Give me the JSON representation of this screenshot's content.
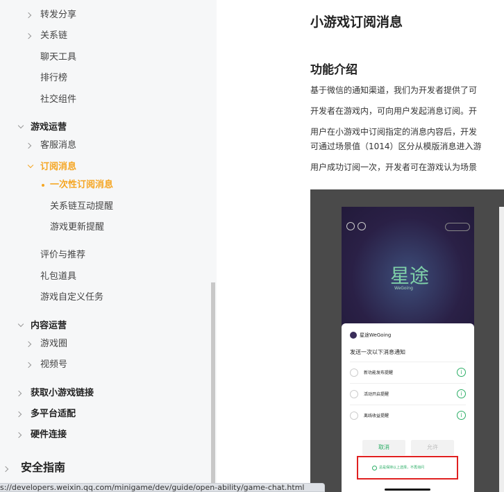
{
  "sidebar": {
    "items": [
      {
        "label": "转发分享"
      },
      {
        "label": "关系链"
      },
      {
        "label": "聊天工具"
      },
      {
        "label": "排行榜"
      },
      {
        "label": "社交组件"
      },
      {
        "label": "游戏运营"
      },
      {
        "label": "客服消息"
      },
      {
        "label": "订阅消息"
      },
      {
        "label": "一次性订阅消息"
      },
      {
        "label": "关系链互动提醒"
      },
      {
        "label": "游戏更新提醒"
      },
      {
        "label": "评价与推荐"
      },
      {
        "label": "礼包道具"
      },
      {
        "label": "游戏自定义任务"
      },
      {
        "label": "内容运营"
      },
      {
        "label": "游戏圈"
      },
      {
        "label": "视频号"
      },
      {
        "label": "获取小游戏链接"
      },
      {
        "label": "多平台适配"
      },
      {
        "label": "硬件连接"
      },
      {
        "label": "安全指南"
      }
    ]
  },
  "content": {
    "title": "小游戏订阅消息",
    "section_title": "功能介绍",
    "paragraphs": [
      "基于微信的通知渠道，我们为开发者提供了可",
      "开发者在游戏内，可向用户发起消息订阅。开",
      "用户在小游戏中订阅指定的消息内容后，开发",
      "可通过场景值（1014）区分从模版消息进入游",
      "用户成功订阅一次，开发者可在游戏认为场景"
    ]
  },
  "screenshot": {
    "logo_text": "星途",
    "logo_sub": "WeGoing",
    "app_name": "星途WeGoing",
    "sheet_title": "发送一次以下消息通知",
    "options": [
      {
        "label": "新功能发布提醒"
      },
      {
        "label": "活动开启提醒"
      },
      {
        "label": "离线收益提醒"
      }
    ],
    "cancel_label": "取消",
    "allow_label": "允许",
    "always_label": "总是保持以上选择，不再询问"
  },
  "status_url": "s://developers.weixin.qq.com/minigame/dev/guide/open-ability/game-chat.html"
}
